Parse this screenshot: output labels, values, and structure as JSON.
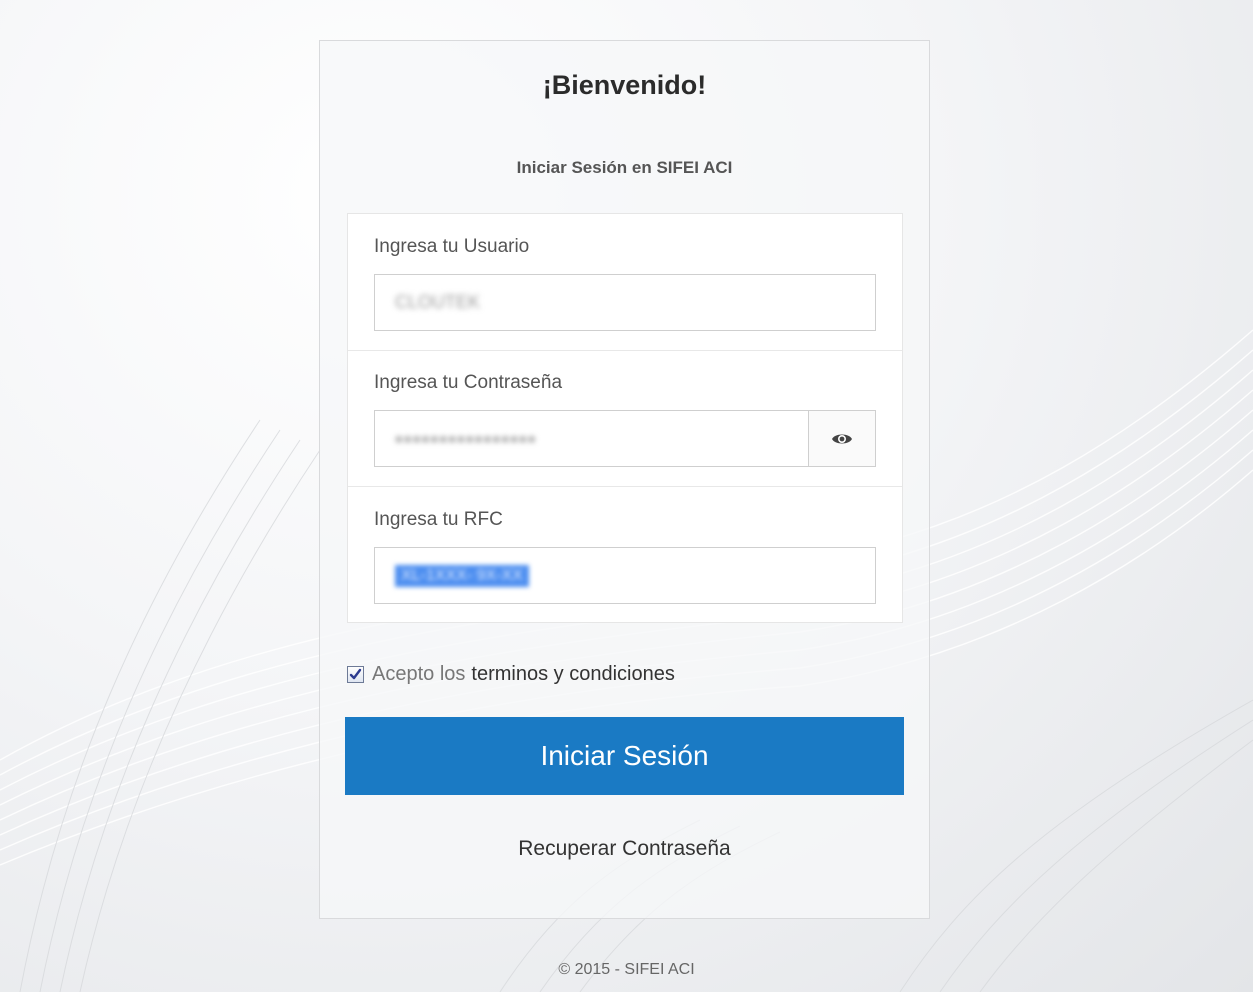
{
  "login": {
    "welcome": "¡Bienvenido!",
    "subtitle": "Iniciar Sesión en SIFEI ACI",
    "user_label": "Ingresa tu Usuario",
    "user_value": "CLOUTEK",
    "password_label": "Ingresa tu Contraseña",
    "password_value": "●●●●●●●●●●●●●●●●",
    "rfc_label": "Ingresa tu RFC",
    "rfc_value": "XL-1XXX- 9X-XX",
    "terms_prefix": "Acepto los",
    "terms_link": "terminos y condiciones",
    "terms_checked": true,
    "submit_label": "Iniciar Sesión",
    "recover_label": "Recuperar Contraseña"
  },
  "footer": {
    "copyright": "© 2015 - SIFEI ACI"
  },
  "colors": {
    "primary": "#1a7ac4",
    "background": "#eef0f2"
  },
  "icons": {
    "show_password": "eye-icon",
    "checkbox": "check-icon"
  }
}
